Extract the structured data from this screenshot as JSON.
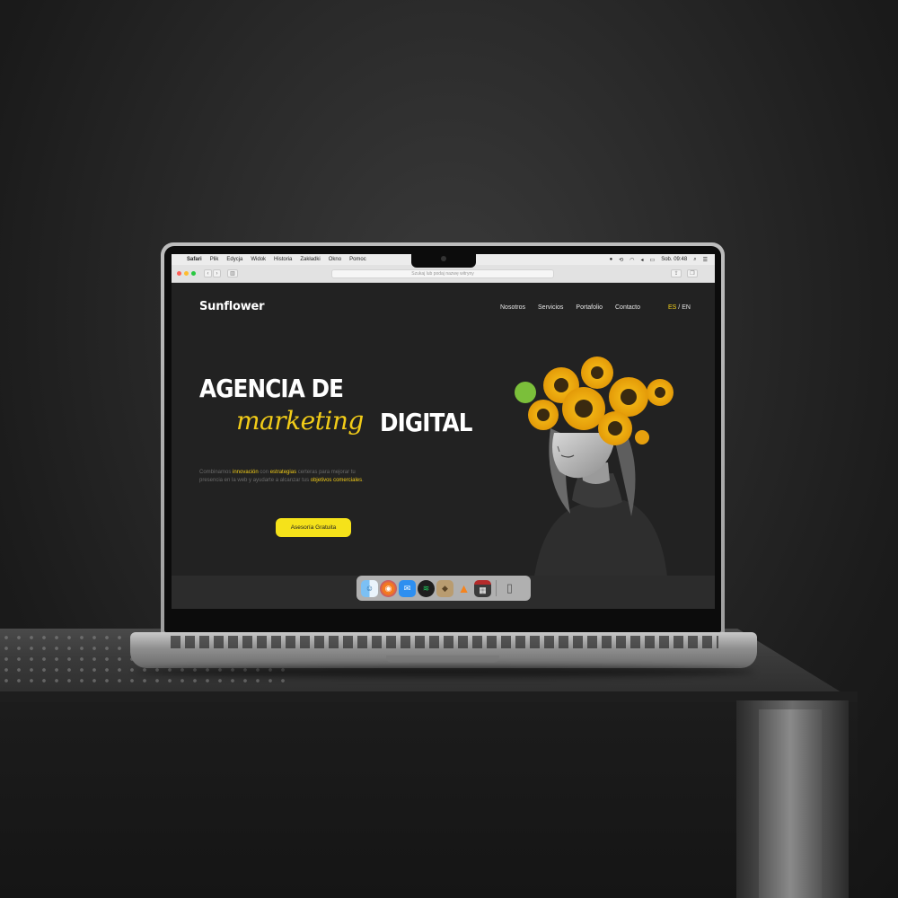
{
  "menubar": {
    "app": "Safari",
    "items": [
      "Plik",
      "Edycja",
      "Widok",
      "Historia",
      "Zakładki",
      "Okno",
      "Pomoc"
    ],
    "clock": "Sob. 09:48"
  },
  "browser": {
    "address_placeholder": "Szukaj lub podaj nazwę witryny"
  },
  "site": {
    "logo": "Sunflower",
    "nav": [
      "Nosotros",
      "Servicios",
      "Portafolio",
      "Contacto"
    ],
    "lang_es": "ES",
    "lang_sep": " / ",
    "lang_en": "EN",
    "hero_line1": "AGENCIA DE",
    "hero_script": "marketing",
    "hero_line2": "DIGITAL",
    "desc_parts": [
      "Combinamos ",
      "innovación",
      " con ",
      "estrategias",
      " certeras para mejorar tu presencia en la web y ayudarte a alcanzar tus ",
      "objetivos comerciales",
      "."
    ],
    "cta": "Asesoría Gratuita"
  },
  "dock": {
    "icons": [
      "finder-icon",
      "firefox-icon",
      "mail-icon",
      "spotify-icon",
      "archive-icon",
      "vlc-icon",
      "photo-booth-icon",
      "trash-icon"
    ]
  },
  "colors": {
    "accent": "#f5d21a",
    "site_bg": "#222222"
  }
}
